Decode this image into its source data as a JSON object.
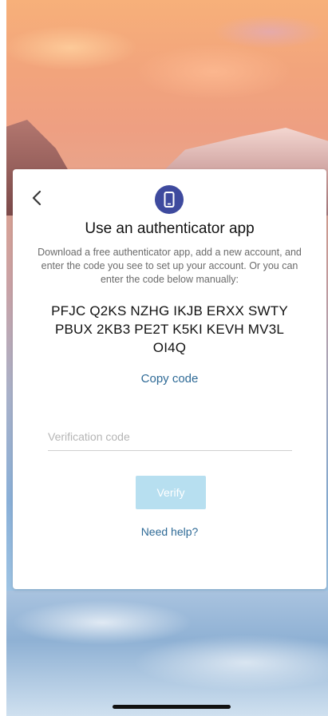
{
  "background": {
    "description_colors": [
      "#f7b07a",
      "#ee9f82",
      "#a9b1c9",
      "#8ab0d8"
    ]
  },
  "icons": {
    "back": "chevron-left-icon",
    "app": "mobile-phone-icon"
  },
  "card": {
    "title": "Use an authenticator app",
    "description": "Download a free authenticator app, add a new account, and enter the code you see to set up your account. Or you can enter the code below manually:",
    "code_line1": "PFJC Q2KS NZHG IKJB ERXX SWTY",
    "code_line2": "PBUX 2KB3 PE2T K5KI KEVH MV3L",
    "code_line3": "OI4Q",
    "copy_code_label": "Copy code",
    "verification_placeholder": "Verification code",
    "verify_label": "Verify",
    "need_help_label": "Need help?"
  },
  "colors": {
    "accent": "#3e4a9e",
    "link": "#2e6a96",
    "verify_disabled": "#b7dff0"
  }
}
